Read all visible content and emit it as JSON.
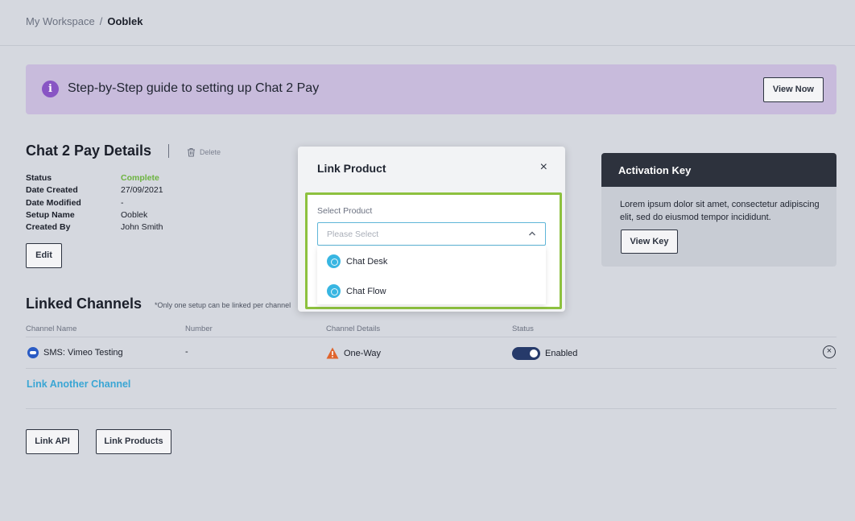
{
  "breadcrumb": {
    "root": "My Workspace",
    "separator": "/",
    "current": "Ooblek"
  },
  "banner": {
    "text": "Step-by-Step guide to setting up Chat 2 Pay",
    "icon": "i",
    "button": "View Now",
    "color": "#c8bbdc"
  },
  "details": {
    "title": "Chat 2 Pay Details",
    "delete_label": "Delete",
    "fields": [
      {
        "key": "Status",
        "value": "Complete"
      },
      {
        "key": "Date Created",
        "value": "27/09/2021"
      },
      {
        "key": "Date Modified",
        "value": "-"
      },
      {
        "key": "Setup Name",
        "value": "Ooblek"
      },
      {
        "key": "Created By",
        "value": "John Smith"
      }
    ],
    "edit_label": "Edit"
  },
  "channels": {
    "title": "Linked Channels",
    "note": "*Only one setup can be linked per channel",
    "columns": [
      "Channel Name",
      "Number",
      "Channel Details",
      "Status"
    ],
    "rows": [
      {
        "name": "SMS: Vimeo Testing",
        "number": "-",
        "details": "One-Way",
        "status": "Enabled"
      }
    ],
    "link_another": "Link Another Channel"
  },
  "actions": {
    "link_api": "Link API",
    "link_products": "Link Products"
  },
  "activation": {
    "title": "Activation Key",
    "body": "Lorem ipsum dolor sit amet, consectetur adipiscing elit, sed do eiusmod tempor incididunt.",
    "button": "View Key"
  },
  "modal": {
    "title": "Link Product",
    "close": "×",
    "select_label": "Select Product",
    "placeholder": "Please Select",
    "options": [
      "Chat Desk",
      "Chat Flow"
    ]
  }
}
